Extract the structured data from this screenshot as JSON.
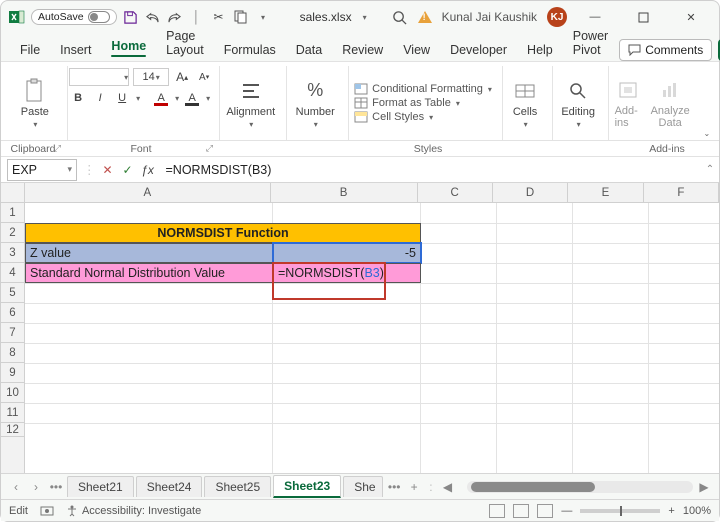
{
  "titlebar": {
    "autosave_label": "AutoSave",
    "autosave_state": "Off",
    "filename": "sales.xlsx",
    "filename_caret": "▾",
    "user_name": "Kunal Jai Kaushik",
    "user_initials": "KJ"
  },
  "tabs": {
    "items": [
      "File",
      "Insert",
      "Home",
      "Page Layout",
      "Formulas",
      "Data",
      "Review",
      "View",
      "Developer",
      "Help",
      "Power Pivot"
    ],
    "active": "Home",
    "comments_label": "Comments"
  },
  "ribbon": {
    "clipboard": {
      "label": "Clipboard",
      "paste_label": "Paste"
    },
    "font": {
      "label": "Font",
      "size_value": "14",
      "bold": "B",
      "italic": "I",
      "underline": "U"
    },
    "alignment": {
      "label": "Alignment",
      "btn_label": "Alignment"
    },
    "number": {
      "label": "Number",
      "btn_label": "Number"
    },
    "styles": {
      "label": "Styles",
      "cond_fmt": "Conditional Formatting",
      "table": "Format as Table",
      "cell_styles": "Cell Styles"
    },
    "cells": {
      "label": "Cells",
      "btn_label": "Cells"
    },
    "editing": {
      "label": "Editing",
      "btn_label": "Editing"
    },
    "addins": {
      "label": "Add-ins",
      "btn_label": "Add-ins",
      "analyze_label": "Analyze Data"
    }
  },
  "formula_bar": {
    "name_box": "EXP",
    "formula": "=NORMSDIST(B3)"
  },
  "grid": {
    "col_labels": [
      "A",
      "B",
      "C",
      "D",
      "E",
      "F"
    ],
    "row_labels": [
      "1",
      "2",
      "3",
      "4",
      "5",
      "6",
      "7",
      "8",
      "9",
      "10",
      "11",
      "12"
    ],
    "cells": {
      "A2B2_title": "NORMSDIST Function",
      "A3": "Z value",
      "B3": "-5",
      "A4": "Standard Normal Distribution Value",
      "B4_display_pre": "=NORMSDIST(",
      "B4_display_ref": "B3",
      "B4_display_post": ")"
    },
    "colors": {
      "title_bg": "#ffc000",
      "row3_bg": "#a7b8da",
      "row4_bg": "#ff9bd8",
      "edit_border": "#c0392b",
      "ref_border": "#2e6bd6",
      "ref_text": "#2e6bd6"
    }
  },
  "sheets": {
    "nav_dots": "•••",
    "tabs": [
      {
        "label": "Sheet21"
      },
      {
        "label": "Sheet24"
      },
      {
        "label": "Sheet25"
      },
      {
        "label": "Sheet23",
        "active": true
      },
      {
        "label": "She",
        "cut": true
      }
    ],
    "more": "•••",
    "add": "+",
    "sep": ":"
  },
  "status": {
    "mode": "Edit",
    "accessibility": "Accessibility: Investigate",
    "zoom": "100%"
  }
}
